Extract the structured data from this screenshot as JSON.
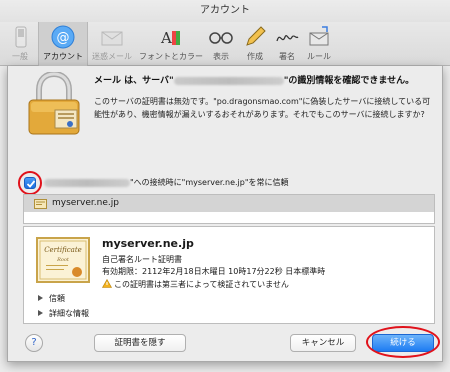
{
  "window": {
    "title": "アカウント"
  },
  "toolbar": {
    "items": [
      {
        "label": "一般",
        "icon": "switch-icon"
      },
      {
        "label": "アカウント",
        "icon": "at-icon",
        "selected": true
      },
      {
        "label": "迷惑メール",
        "icon": "junk-mail-icon"
      },
      {
        "label": "フォントとカラー",
        "icon": "fonts-colors-icon"
      },
      {
        "label": "表示",
        "icon": "glasses-icon"
      },
      {
        "label": "作成",
        "icon": "pencil-icon"
      },
      {
        "label": "署名",
        "icon": "signature-icon"
      },
      {
        "label": "ルール",
        "icon": "rules-icon"
      }
    ]
  },
  "dialog": {
    "title_prefix": "メール は、サーバ\"",
    "title_suffix": "\"の識別情報を確認できません。",
    "body": "このサーバの証明書は無効です。\"po.dragonsmao.com\"に偽装したサーバに接続している可能性があり、機密情報が漏えいするおそれがあります。それでもこのサーバに接続しますか?",
    "trust_text": "\"への接続時に\"myserver.ne.jp\"を常に信頼",
    "trust_checked": true,
    "cert_list_item": "myserver.ne.jp",
    "cert": {
      "name": "myserver.ne.jp",
      "type": "自己署名ルート証明書",
      "expires": "有効期限：2112年2月18日木曜日 10時17分22秒 日本標準時",
      "warning": "この証明書は第三者によって検証されていません",
      "image_caption": "Certificate",
      "image_sub": "Root"
    },
    "trust_section": "信頼",
    "details_section": "詳細な情報",
    "help_label": "?",
    "hide_cert_button": "証明書を隠す",
    "cancel_button": "キャンセル",
    "continue_button": "続ける"
  },
  "colors": {
    "accent": "#1e7cf2",
    "highlight_circle": "#e0121b"
  }
}
